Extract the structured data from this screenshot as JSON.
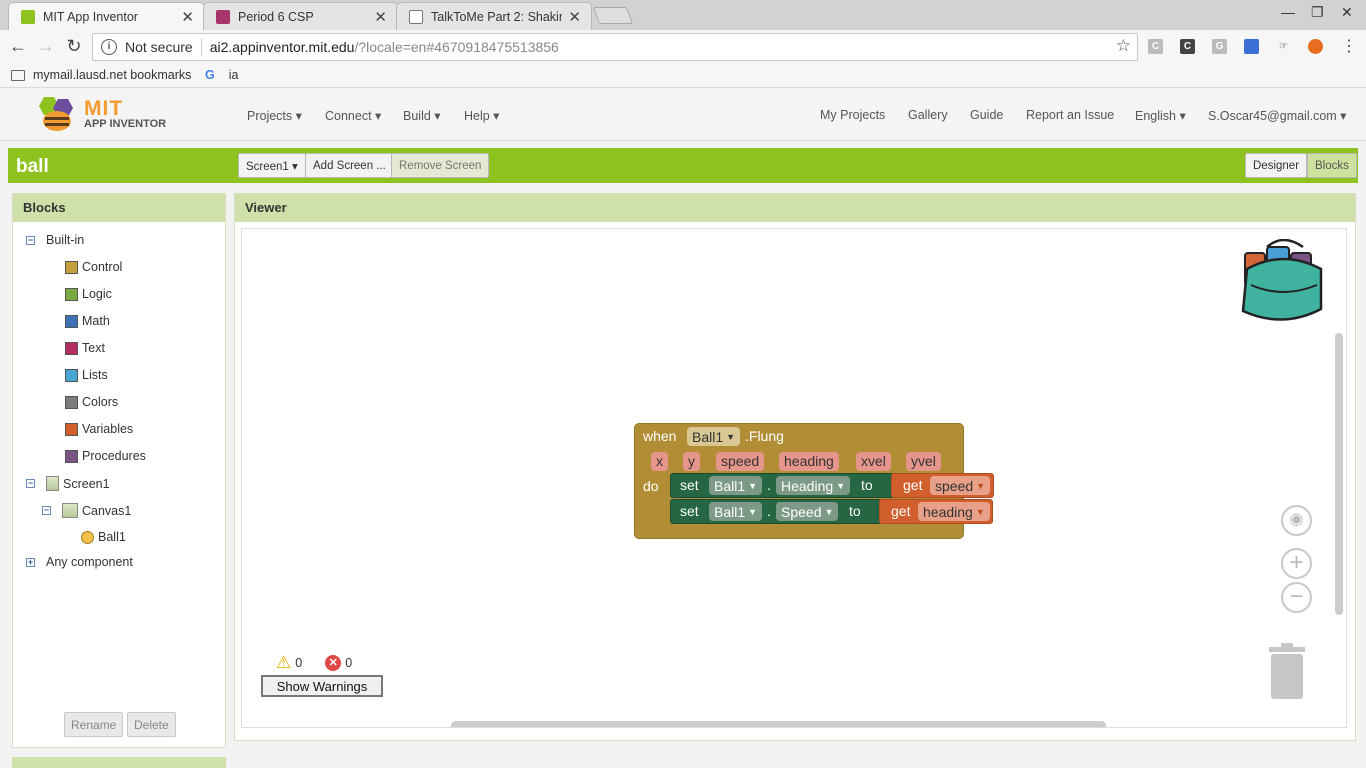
{
  "browser": {
    "tabs": [
      {
        "title": "MIT App Inventor",
        "active": true
      },
      {
        "title": "Period 6 CSP",
        "active": false
      },
      {
        "title": "TalkToMe Part 2: Shakin",
        "active": false
      }
    ],
    "security_label": "Not secure",
    "url_host": "ai2.appinventor.mit.edu",
    "url_path": "/?locale=en#4670918475513856",
    "bookmarks": [
      "mymail.lausd.net bookmarks",
      "ia"
    ]
  },
  "header": {
    "logo_mit": "MIT",
    "logo_sub": "APP INVENTOR",
    "menu": [
      "Projects ▾",
      "Connect ▾",
      "Build ▾",
      "Help ▾"
    ],
    "right_menu": [
      "My Projects",
      "Gallery",
      "Guide",
      "Report an Issue",
      "English ▾",
      "S.Oscar45@gmail.com ▾"
    ]
  },
  "project": {
    "name": "ball",
    "screen_select": "Screen1 ▾",
    "add_screen": "Add Screen ...",
    "remove_screen": "Remove Screen",
    "designer": "Designer",
    "blocks": "Blocks"
  },
  "blocks_panel": {
    "title": "Blocks",
    "builtin_label": "Built-in",
    "builtin": [
      {
        "label": "Control",
        "color": "#c59f3c"
      },
      {
        "label": "Logic",
        "color": "#77ab41"
      },
      {
        "label": "Math",
        "color": "#3f71b5"
      },
      {
        "label": "Text",
        "color": "#b32d5e"
      },
      {
        "label": "Lists",
        "color": "#49a6d4"
      },
      {
        "label": "Colors",
        "color": "#7d7d7d"
      },
      {
        "label": "Variables",
        "color": "#d05f2d"
      },
      {
        "label": "Procedures",
        "color": "#7c5385"
      }
    ],
    "screen": "Screen1",
    "canvas": "Canvas1",
    "ball": "Ball1",
    "any_component": "Any component",
    "rename": "Rename",
    "delete": "Delete"
  },
  "viewer": {
    "title": "Viewer",
    "block": {
      "when": "when",
      "component": "Ball1",
      "event": ".Flung",
      "params": [
        "x",
        "y",
        "speed",
        "heading",
        "xvel",
        "yvel"
      ],
      "do": "do",
      "set": "set",
      "dot": ".",
      "to": "to",
      "get": "get",
      "stmt1": {
        "component": "Ball1",
        "property": "Heading",
        "var": "speed"
      },
      "stmt2": {
        "component": "Ball1",
        "property": "Speed",
        "var": "heading"
      }
    },
    "warnings_count": "0",
    "errors_count": "0",
    "show_warnings": "Show Warnings"
  }
}
